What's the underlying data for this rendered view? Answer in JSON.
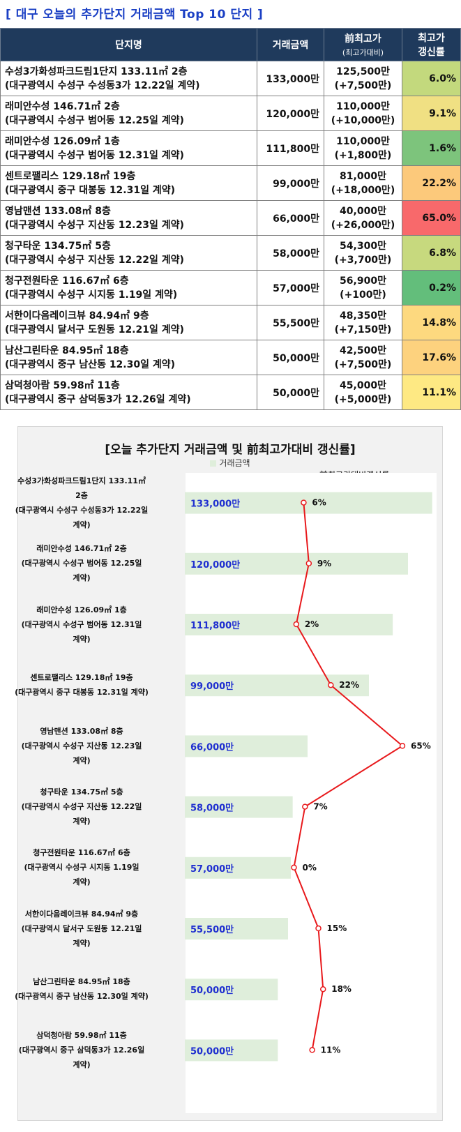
{
  "title": "[ 대구 오늘의 추가단지 거래금액 Top 10 단지 ]",
  "table": {
    "headers": {
      "name": "단지명",
      "price": "거래금액",
      "prev_main": "前최고가",
      "prev_sub": "(최고가대비)",
      "rate_line1": "최고가",
      "rate_line2": "갱신률"
    },
    "rows": [
      {
        "name": "수성3가화성파크드림1단지 133.11㎡ 2층",
        "loc": "(대구광역시 수성구 수성동3가 12.22일 계약)",
        "price": "133,000만",
        "prev": "125,500만",
        "diff": "(+7,500만)",
        "rate": "6.0%",
        "rate_color": "#c3d97d"
      },
      {
        "name": "래미안수성 146.71㎡ 2층",
        "loc": "(대구광역시 수성구 범어동 12.25일 계약)",
        "price": "120,000만",
        "prev": "110,000만",
        "diff": "(+10,000만)",
        "rate": "9.1%",
        "rate_color": "#f0e083"
      },
      {
        "name": "래미안수성 126.09㎡ 1층",
        "loc": "(대구광역시 수성구 범어동 12.31일 계약)",
        "price": "111,800만",
        "prev": "110,000만",
        "diff": "(+1,800만)",
        "rate": "1.6%",
        "rate_color": "#7dc47c"
      },
      {
        "name": "센트로팰리스 129.18㎡ 19층",
        "loc": "(대구광역시 중구 대봉동 12.31일 계약)",
        "price": "99,000만",
        "prev": "81,000만",
        "diff": "(+18,000만)",
        "rate": "22.2%",
        "rate_color": "#fcc97b"
      },
      {
        "name": "영남맨션 133.08㎡ 8층",
        "loc": "(대구광역시 수성구 지산동 12.23일 계약)",
        "price": "66,000만",
        "prev": "40,000만",
        "diff": "(+26,000만)",
        "rate": "65.0%",
        "rate_color": "#f8696b"
      },
      {
        "name": "청구타운 134.75㎡ 5층",
        "loc": "(대구광역시 수성구 지산동 12.22일 계약)",
        "price": "58,000만",
        "prev": "54,300만",
        "diff": "(+3,700만)",
        "rate": "6.8%",
        "rate_color": "#c7d97e"
      },
      {
        "name": "청구전원타운 116.67㎡ 6층",
        "loc": "(대구광역시 수성구 시지동 1.19일 계약)",
        "price": "57,000만",
        "prev": "56,900만",
        "diff": "(+100만)",
        "rate": "0.2%",
        "rate_color": "#63be7b"
      },
      {
        "name": "서한이다음레이크뷰 84.94㎡ 9층",
        "loc": "(대구광역시 달서구 도원동 12.21일 계약)",
        "price": "55,500만",
        "prev": "48,350만",
        "diff": "(+7,150만)",
        "rate": "14.8%",
        "rate_color": "#fdd97f"
      },
      {
        "name": "남산그린타운 84.95㎡ 18층",
        "loc": "(대구광역시 중구 남산동 12.30일 계약)",
        "price": "50,000만",
        "prev": "42,500만",
        "diff": "(+7,500만)",
        "rate": "17.6%",
        "rate_color": "#fdd27e"
      },
      {
        "name": "삼덕청아람 59.98㎡ 11층",
        "loc": "(대구광역시 중구 삼덕동3가 12.26일 계약)",
        "price": "50,000만",
        "prev": "45,000만",
        "diff": "(+5,000만)",
        "rate": "11.1%",
        "rate_color": "#fee983"
      }
    ]
  },
  "chart_data": {
    "type": "bar",
    "title": "[오늘 추가단지 거래금액 및 前최고가대비 갱신률]",
    "orientation": "horizontal",
    "bar_color": "#dfeedb",
    "line_color": "#e8191c",
    "categories": [
      [
        "수성3가화성파크드림1단지 133.11㎡",
        "2층",
        "(대구광역시 수성구 수성동3가 12.22일",
        "계약)"
      ],
      [
        "래미안수성 146.71㎡ 2층",
        "(대구광역시 수성구 범어동 12.25일",
        "계약)"
      ],
      [
        "래미안수성 126.09㎡ 1층",
        "(대구광역시 수성구 범어동 12.31일",
        "계약)"
      ],
      [
        "센트로팰리스 129.18㎡ 19층",
        "(대구광역시 중구 대봉동 12.31일 계약)"
      ],
      [
        "영남맨션 133.08㎡ 8층",
        "(대구광역시 수성구 지산동 12.23일",
        "계약)"
      ],
      [
        "청구타운 134.75㎡ 5층",
        "(대구광역시 수성구 지산동 12.22일",
        "계약)"
      ],
      [
        "청구전원타운 116.67㎡ 6층",
        "(대구광역시 수성구 시지동 1.19일",
        "계약)"
      ],
      [
        "서한이다음레이크뷰 84.94㎡ 9층",
        "(대구광역시 달서구 도원동 12.21일",
        "계약)"
      ],
      [
        "남산그린타운 84.95㎡ 18층",
        "(대구광역시 중구 남산동 12.30일 계약)"
      ],
      [
        "삼덕청아람 59.98㎡ 11층",
        "(대구광역시 중구 삼덕동3가 12.26일",
        "계약)"
      ]
    ],
    "series": [
      {
        "name": "거래금액",
        "kind": "bar",
        "values": [
          133000,
          120000,
          111800,
          99000,
          66000,
          58000,
          57000,
          55500,
          50000,
          50000
        ],
        "labels": [
          "133,000만",
          "120,000만",
          "111,800만",
          "99,000만",
          "66,000만",
          "58,000만",
          "57,000만",
          "55,500만",
          "50,000만",
          "50,000만"
        ]
      },
      {
        "name": "前최고가대비갱신률",
        "kind": "line",
        "values": [
          6.0,
          9.1,
          1.6,
          22.2,
          65.0,
          6.8,
          0.2,
          14.8,
          17.6,
          11.1
        ],
        "labels": [
          "6%",
          "9%",
          "2%",
          "22%",
          "65%",
          "7%",
          "0%",
          "15%",
          "18%",
          "11%"
        ]
      }
    ],
    "bar_axis": {
      "min": 0,
      "max": 135000
    },
    "line_axis": {
      "min": -65,
      "max": 85
    },
    "legend": "top",
    "grid": false
  }
}
